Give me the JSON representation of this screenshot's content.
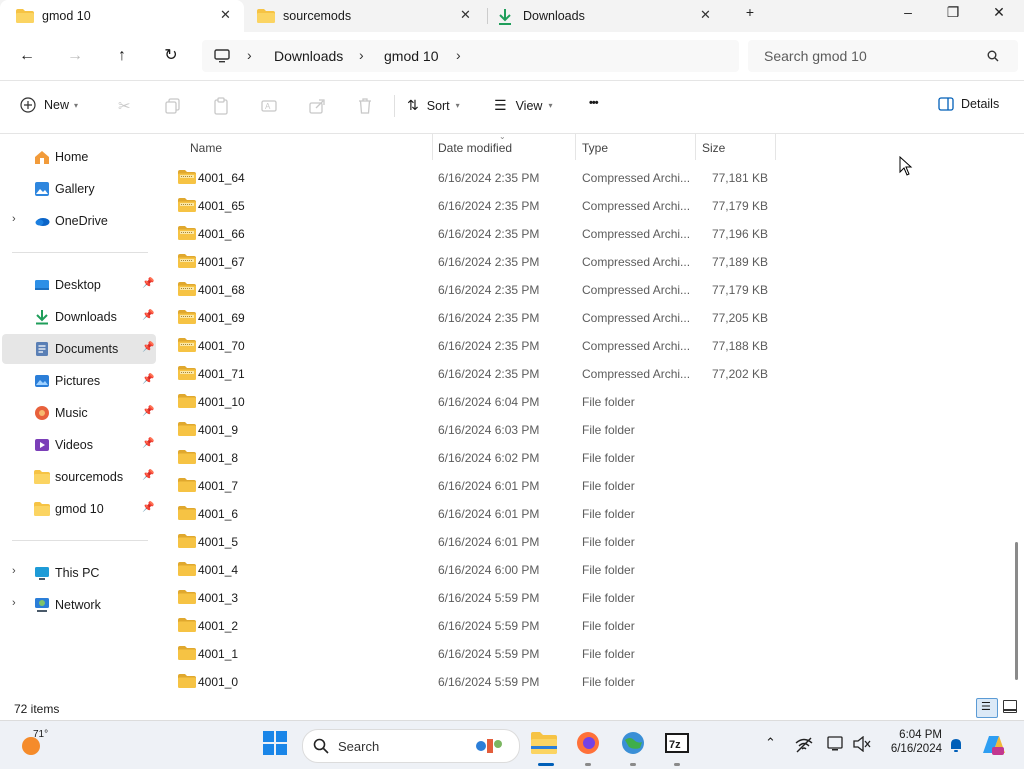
{
  "tabs": [
    {
      "label": "gmod 10",
      "icon": "folder-icon",
      "active": true
    },
    {
      "label": "sourcemods",
      "icon": "folder-icon",
      "active": false
    },
    {
      "label": "Downloads",
      "icon": "download-icon",
      "active": false
    }
  ],
  "window_controls": {
    "new_tab": "+",
    "minimize": "–",
    "maximize": "❐",
    "close": "✕"
  },
  "address": {
    "crumbs": [
      "Downloads",
      "gmod 10"
    ],
    "search_placeholder": "Search gmod 10"
  },
  "toolbar": {
    "new_label": "New",
    "sort_label": "Sort",
    "view_label": "View",
    "more_label": "•••",
    "details_label": "Details"
  },
  "sidebar": {
    "top": [
      {
        "label": "Home",
        "icon": "home-icon"
      },
      {
        "label": "Gallery",
        "icon": "gallery-icon"
      },
      {
        "label": "OneDrive",
        "icon": "onedrive-icon",
        "expandable": true
      }
    ],
    "quick": [
      {
        "label": "Desktop",
        "icon": "desktop-icon"
      },
      {
        "label": "Downloads",
        "icon": "download-icon"
      },
      {
        "label": "Documents",
        "icon": "documents-icon",
        "selected": true
      },
      {
        "label": "Pictures",
        "icon": "pictures-icon"
      },
      {
        "label": "Music",
        "icon": "music-icon"
      },
      {
        "label": "Videos",
        "icon": "videos-icon"
      },
      {
        "label": "sourcemods",
        "icon": "folder-icon"
      },
      {
        "label": "gmod 10",
        "icon": "folder-icon"
      }
    ],
    "bottom": [
      {
        "label": "This PC",
        "icon": "pc-icon"
      },
      {
        "label": "Network",
        "icon": "network-icon"
      }
    ]
  },
  "columns": {
    "name": "Name",
    "date": "Date modified",
    "type": "Type",
    "size": "Size"
  },
  "files": [
    {
      "name": "4001_64",
      "date": "6/16/2024 2:35 PM",
      "type": "Compressed Archi...",
      "size": "77,181 KB",
      "kind": "zip"
    },
    {
      "name": "4001_65",
      "date": "6/16/2024 2:35 PM",
      "type": "Compressed Archi...",
      "size": "77,179 KB",
      "kind": "zip"
    },
    {
      "name": "4001_66",
      "date": "6/16/2024 2:35 PM",
      "type": "Compressed Archi...",
      "size": "77,196 KB",
      "kind": "zip"
    },
    {
      "name": "4001_67",
      "date": "6/16/2024 2:35 PM",
      "type": "Compressed Archi...",
      "size": "77,189 KB",
      "kind": "zip"
    },
    {
      "name": "4001_68",
      "date": "6/16/2024 2:35 PM",
      "type": "Compressed Archi...",
      "size": "77,179 KB",
      "kind": "zip"
    },
    {
      "name": "4001_69",
      "date": "6/16/2024 2:35 PM",
      "type": "Compressed Archi...",
      "size": "77,205 KB",
      "kind": "zip"
    },
    {
      "name": "4001_70",
      "date": "6/16/2024 2:35 PM",
      "type": "Compressed Archi...",
      "size": "77,188 KB",
      "kind": "zip"
    },
    {
      "name": "4001_71",
      "date": "6/16/2024 2:35 PM",
      "type": "Compressed Archi...",
      "size": "77,202 KB",
      "kind": "zip"
    },
    {
      "name": "4001_10",
      "date": "6/16/2024 6:04 PM",
      "type": "File folder",
      "size": "",
      "kind": "folder"
    },
    {
      "name": "4001_9",
      "date": "6/16/2024 6:03 PM",
      "type": "File folder",
      "size": "",
      "kind": "folder"
    },
    {
      "name": "4001_8",
      "date": "6/16/2024 6:02 PM",
      "type": "File folder",
      "size": "",
      "kind": "folder"
    },
    {
      "name": "4001_7",
      "date": "6/16/2024 6:01 PM",
      "type": "File folder",
      "size": "",
      "kind": "folder"
    },
    {
      "name": "4001_6",
      "date": "6/16/2024 6:01 PM",
      "type": "File folder",
      "size": "",
      "kind": "folder"
    },
    {
      "name": "4001_5",
      "date": "6/16/2024 6:01 PM",
      "type": "File folder",
      "size": "",
      "kind": "folder"
    },
    {
      "name": "4001_4",
      "date": "6/16/2024 6:00 PM",
      "type": "File folder",
      "size": "",
      "kind": "folder"
    },
    {
      "name": "4001_3",
      "date": "6/16/2024 5:59 PM",
      "type": "File folder",
      "size": "",
      "kind": "folder"
    },
    {
      "name": "4001_2",
      "date": "6/16/2024 5:59 PM",
      "type": "File folder",
      "size": "",
      "kind": "folder"
    },
    {
      "name": "4001_1",
      "date": "6/16/2024 5:59 PM",
      "type": "File folder",
      "size": "",
      "kind": "folder"
    },
    {
      "name": "4001_0",
      "date": "6/16/2024 5:59 PM",
      "type": "File folder",
      "size": "",
      "kind": "folder"
    }
  ],
  "status": {
    "item_count": "72 items"
  },
  "taskbar": {
    "weather_temp": "71°",
    "search_label": "Search",
    "time": "6:04 PM",
    "date": "6/16/2024"
  },
  "colors": {
    "accent": "#005fb8",
    "folder": "#f6c344",
    "folder_dark": "#e0a82e",
    "selected_bg": "#e6e6e6"
  }
}
